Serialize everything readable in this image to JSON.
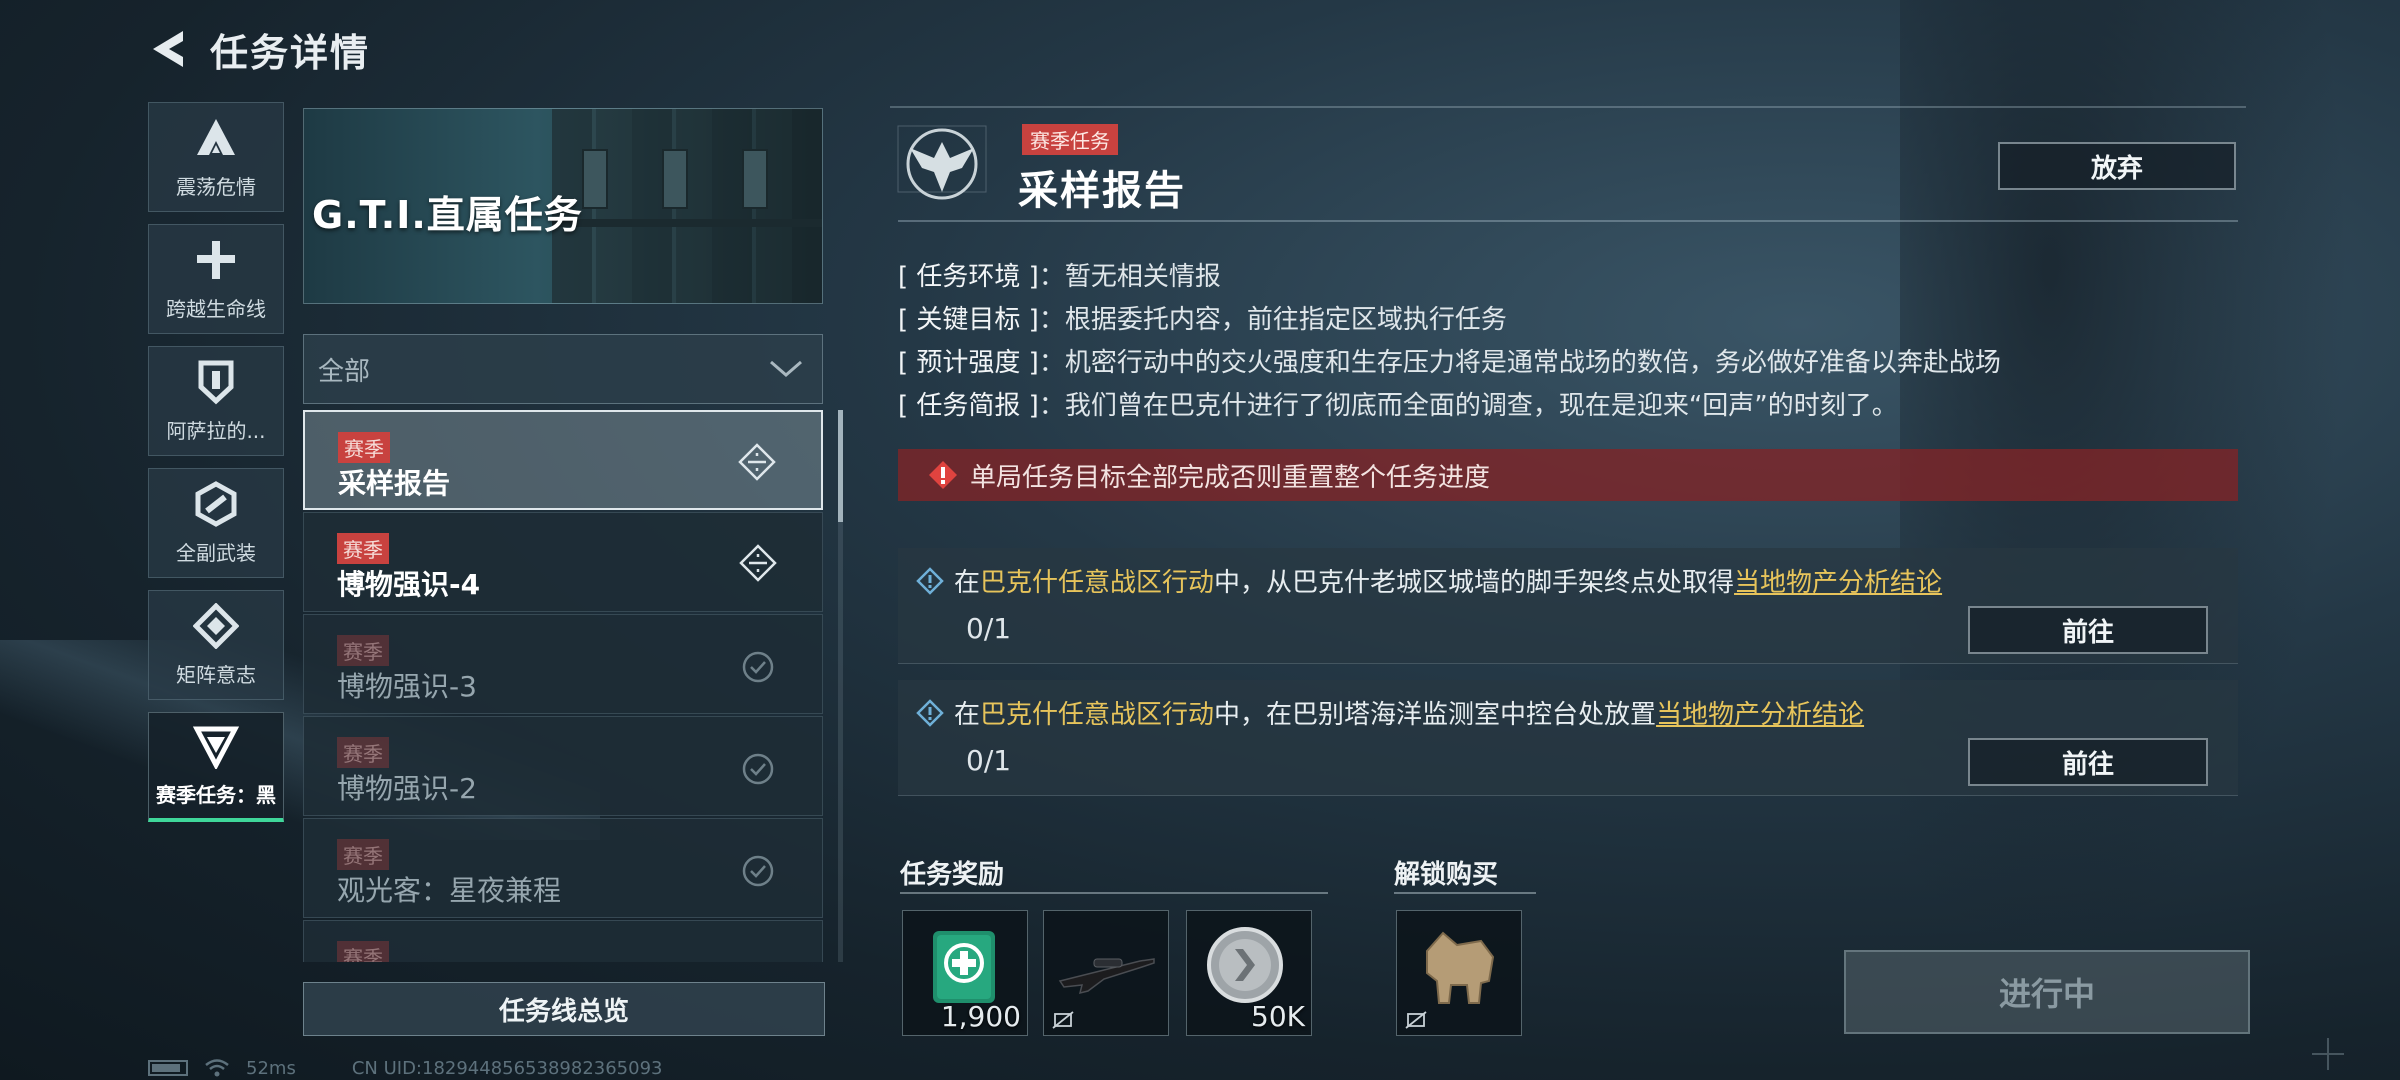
{
  "header": {
    "title": "任务详情"
  },
  "rail": {
    "items": [
      {
        "label": "震荡危情",
        "icon": "delta-a-icon"
      },
      {
        "label": "跨越生命线",
        "icon": "plus-cross-icon"
      },
      {
        "label": "阿萨拉的...",
        "icon": "shield-icon"
      },
      {
        "label": "全副武装",
        "icon": "armor-hex-icon"
      },
      {
        "label": "矩阵意志",
        "icon": "matrix-diamond-icon"
      },
      {
        "label": "赛季任务：黑",
        "icon": "season-triangle-icon",
        "active": true
      }
    ]
  },
  "banner": {
    "title": "G.T.I.直属任务"
  },
  "filter": {
    "selected": "全部"
  },
  "missions": [
    {
      "tag": "赛季",
      "name": "采样报告",
      "state": "selected",
      "icon": "target-diamond-icon"
    },
    {
      "tag": "赛季",
      "name": "博物强识-4",
      "state": "active",
      "icon": "target-diamond-icon"
    },
    {
      "tag": "赛季",
      "name": "博物强识-3",
      "state": "done",
      "icon": "check-medal-icon"
    },
    {
      "tag": "赛季",
      "name": "博物强识-2",
      "state": "done",
      "icon": "check-medal-icon"
    },
    {
      "tag": "赛季",
      "name": "观光客：星夜兼程",
      "state": "done",
      "icon": "check-medal-icon"
    },
    {
      "tag": "赛季",
      "name": "",
      "state": "done",
      "icon": ""
    }
  ],
  "overview_button": "任务线总览",
  "status_bar": {
    "ping": "52ms",
    "uid": "CN UID:18294485653898236​5093"
  },
  "detail": {
    "tag": "赛季任务",
    "title": "采样报告",
    "abandon_label": "放弃",
    "info": [
      {
        "key": "[ 任务环境 ]",
        "value": "：暂无相关情报"
      },
      {
        "key": "[ 关键目标 ]",
        "value": "：根据委托内容，前往指定区域执行任务"
      },
      {
        "key": "[ 预计强度 ]",
        "value": "：机密行动中的交火强度和生存压力将是通常战场的数倍，务必做好准备以奔赴战场"
      },
      {
        "key": "[ 任务简报 ]",
        "value": "：我们曾在巴克什进行了彻底而全面的调查，现在是迎来“回声”的时刻了。"
      }
    ],
    "warning": "单局任务目标全部完成否则重置整个任务进度",
    "objectives": [
      {
        "pre": "在",
        "highlight": "巴克什任意战区行动",
        "mid": "中，从巴克什老城区城墙的脚手架终点处取得",
        "link": "当地物产分析结论",
        "progress": "0/1",
        "go_label": "前往"
      },
      {
        "pre": "在",
        "highlight": "巴克什任意战区行动",
        "mid": "中，在巴别塔海洋监测室中控台处放置",
        "link": "当地物产分析结论",
        "progress": "0/1",
        "go_label": "前往"
      }
    ],
    "rewards_title": "任务奖励",
    "rewards": [
      {
        "name": "medical-kit-item",
        "amount": "1,900"
      },
      {
        "name": "sniper-rifle-item",
        "amount": ""
      },
      {
        "name": "silver-coin-item",
        "amount": "50K"
      }
    ],
    "unlock_title": "解锁购买",
    "unlock_items": [
      {
        "name": "artifact-statue-item"
      }
    ],
    "status_button": "进行中"
  },
  "colors": {
    "accent_green": "#3fd79a",
    "season_red": "#c8423f",
    "highlight_gold": "#e7c45b"
  }
}
